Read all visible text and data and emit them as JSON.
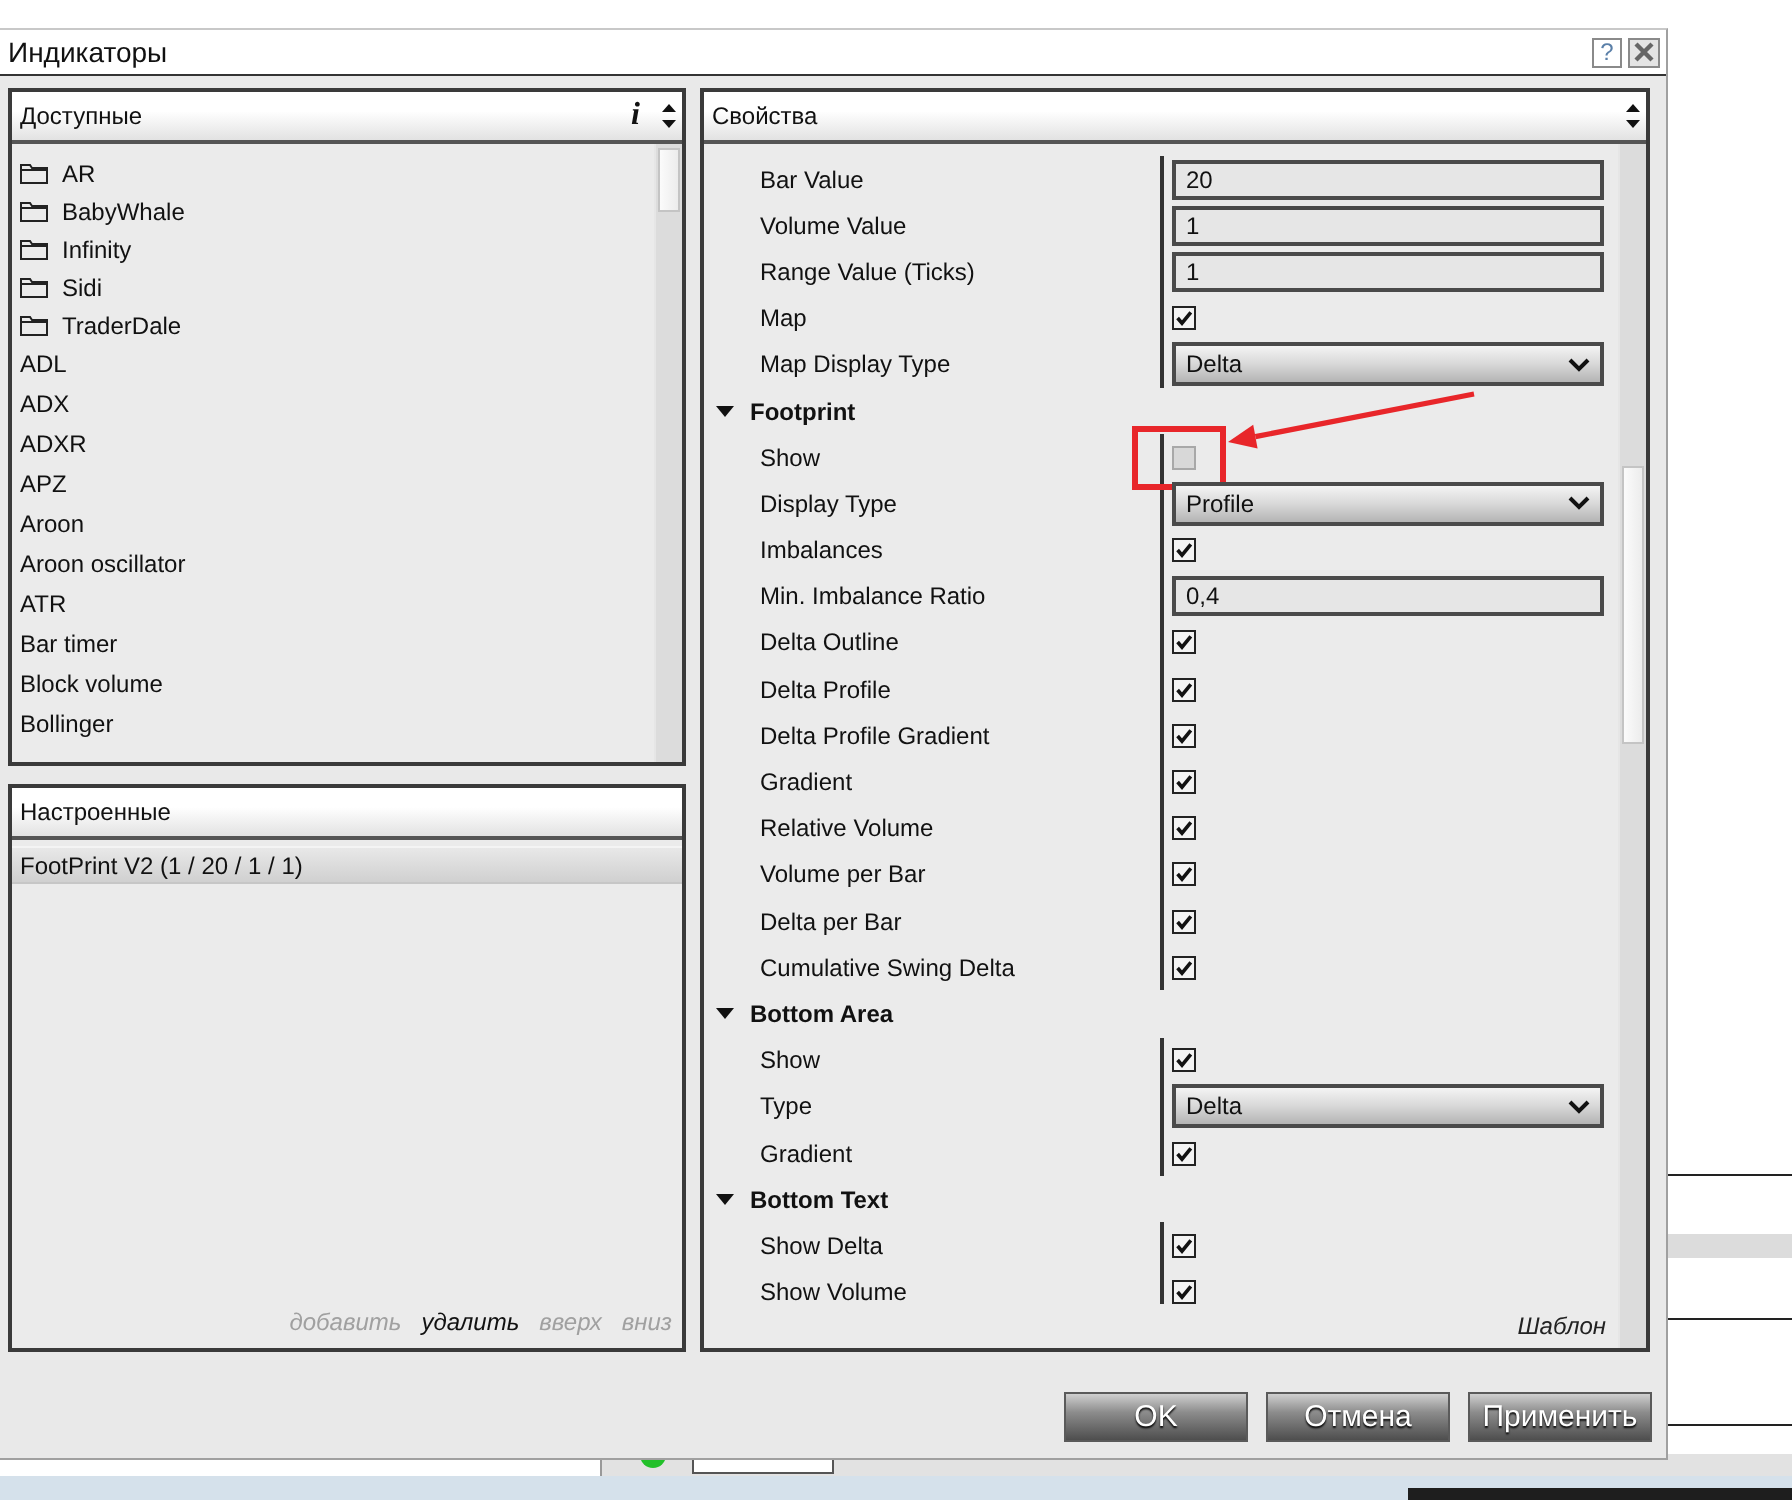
{
  "window": {
    "title": "Индикаторы",
    "help": "?"
  },
  "available": {
    "title": "Доступные",
    "info": "i",
    "items": [
      {
        "label": "AR",
        "kind": "folder",
        "selected": false
      },
      {
        "label": "BabyWhale",
        "kind": "folder",
        "selected": false
      },
      {
        "label": "Infinity",
        "kind": "folder",
        "selected": false
      },
      {
        "label": "Sidi",
        "kind": "folder",
        "selected": false
      },
      {
        "label": "TraderDale",
        "kind": "folder",
        "selected": false
      },
      {
        "label": "ADL",
        "kind": "indicator",
        "selected": false
      },
      {
        "label": "ADX",
        "kind": "indicator",
        "selected": false
      },
      {
        "label": "ADXR",
        "kind": "indicator",
        "selected": false
      },
      {
        "label": "APZ",
        "kind": "indicator",
        "selected": false
      },
      {
        "label": "Aroon",
        "kind": "indicator",
        "selected": false
      },
      {
        "label": "Aroon oscillator",
        "kind": "indicator",
        "selected": false
      },
      {
        "label": "ATR",
        "kind": "indicator",
        "selected": false
      },
      {
        "label": "Bar timer",
        "kind": "indicator",
        "selected": false
      },
      {
        "label": "Block volume",
        "kind": "indicator",
        "selected": false
      },
      {
        "label": "Bollinger",
        "kind": "indicator",
        "selected": false
      }
    ]
  },
  "configured": {
    "title": "Настроенные",
    "items": [
      {
        "label": "FootPrint V2 (1 / 20 / 1 / 1)",
        "selected": true
      }
    ],
    "actions": [
      {
        "label": "добавить",
        "disabled": true
      },
      {
        "label": "удалить",
        "disabled": false
      },
      {
        "label": "вверх",
        "disabled": true
      },
      {
        "label": "вниз",
        "disabled": true
      }
    ]
  },
  "properties": {
    "title": "Свойства",
    "rows": [
      {
        "kind": "text",
        "label": "Bar Value",
        "value": "20"
      },
      {
        "kind": "text",
        "label": "Volume Value",
        "value": "1"
      },
      {
        "kind": "text",
        "label": "Range Value (Ticks)",
        "value": "1"
      },
      {
        "kind": "checkbox",
        "label": "Map",
        "checked": true
      },
      {
        "kind": "dropdown",
        "label": "Map Display Type",
        "value": "Delta"
      },
      {
        "kind": "category",
        "label": "Footprint",
        "expanded": true,
        "children": [
          {
            "kind": "checkbox",
            "label": "Show",
            "checked": false,
            "annotated": true
          },
          {
            "kind": "dropdown",
            "label": "Display Type",
            "value": "Profile"
          },
          {
            "kind": "checkbox",
            "label": "Imbalances",
            "checked": true
          },
          {
            "kind": "text",
            "label": "Min. Imbalance Ratio",
            "value": "0,4"
          },
          {
            "kind": "checkbox",
            "label": "Delta Outline",
            "checked": true
          },
          {
            "kind": "checkbox",
            "label": "Delta Profile",
            "checked": true
          },
          {
            "kind": "checkbox",
            "label": "Delta Profile Gradient",
            "checked": true
          },
          {
            "kind": "checkbox",
            "label": "Gradient",
            "checked": true
          },
          {
            "kind": "checkbox",
            "label": "Relative Volume",
            "checked": true
          },
          {
            "kind": "checkbox",
            "label": "Volume per Bar",
            "checked": true
          },
          {
            "kind": "checkbox",
            "label": "Delta per Bar",
            "checked": true
          },
          {
            "kind": "checkbox",
            "label": "Cumulative Swing Delta",
            "checked": true
          }
        ]
      },
      {
        "kind": "category",
        "label": "Bottom Area",
        "expanded": true,
        "children": [
          {
            "kind": "checkbox",
            "label": "Show",
            "checked": true
          },
          {
            "kind": "dropdown",
            "label": "Type",
            "value": "Delta"
          },
          {
            "kind": "checkbox",
            "label": "Gradient",
            "checked": true
          }
        ]
      },
      {
        "kind": "category",
        "label": "Bottom Text",
        "expanded": true,
        "children": [
          {
            "kind": "checkbox",
            "label": "Show Delta",
            "checked": true
          },
          {
            "kind": "checkbox",
            "label": "Show Volume",
            "checked": true
          }
        ]
      }
    ],
    "template_link": "Шаблон"
  },
  "buttons": [
    {
      "label": "OK"
    },
    {
      "label": "Отмена"
    },
    {
      "label": "Применить"
    }
  ]
}
